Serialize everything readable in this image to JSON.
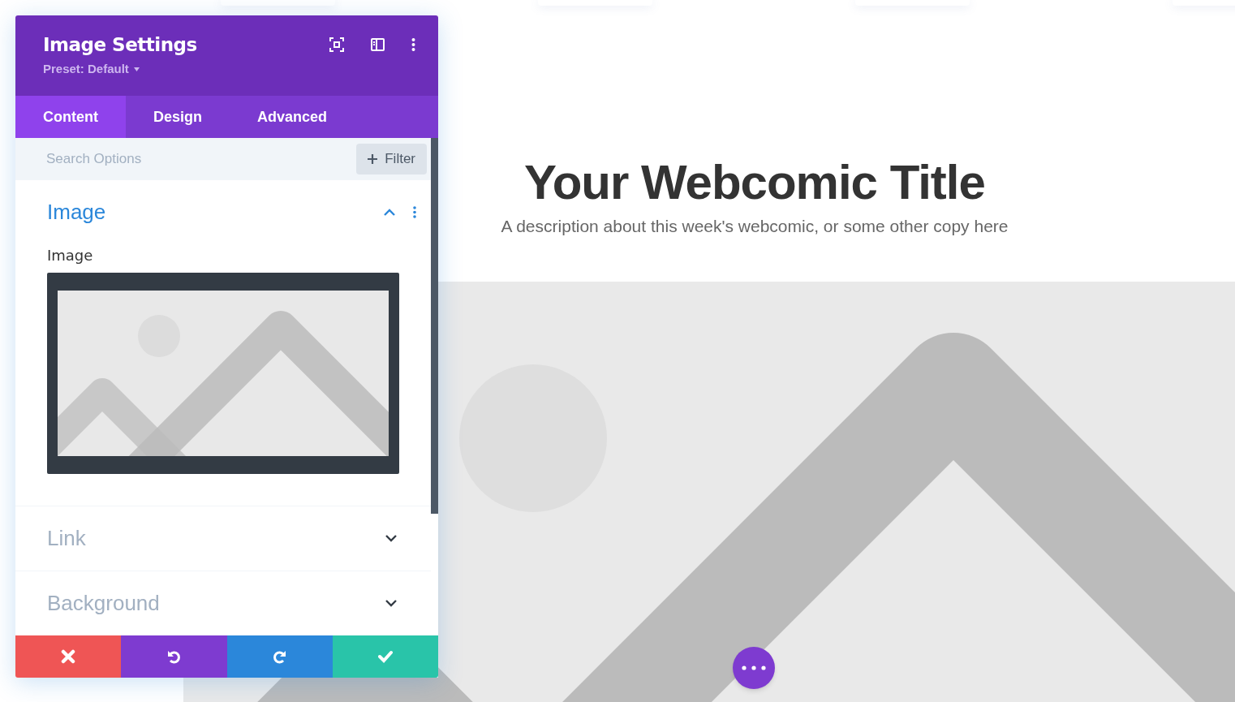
{
  "page": {
    "title": "Your Webcomic Title",
    "description": "A description about this week's webcomic, or some other copy here"
  },
  "panel": {
    "title": "Image Settings",
    "preset": "Preset: Default",
    "tabs": [
      {
        "label": "Content",
        "selected": true
      },
      {
        "label": "Design",
        "selected": false
      },
      {
        "label": "Advanced",
        "selected": false
      }
    ],
    "search": {
      "placeholder": "Search Options"
    },
    "filter_button": "Filter",
    "sections": [
      {
        "title": "Image",
        "expanded": true,
        "field_label": "Image"
      },
      {
        "title": "Link",
        "expanded": false
      },
      {
        "title": "Background",
        "expanded": false
      }
    ],
    "footer_buttons": [
      {
        "kind": "discard"
      },
      {
        "kind": "undo"
      },
      {
        "kind": "redo"
      },
      {
        "kind": "save"
      }
    ]
  }
}
